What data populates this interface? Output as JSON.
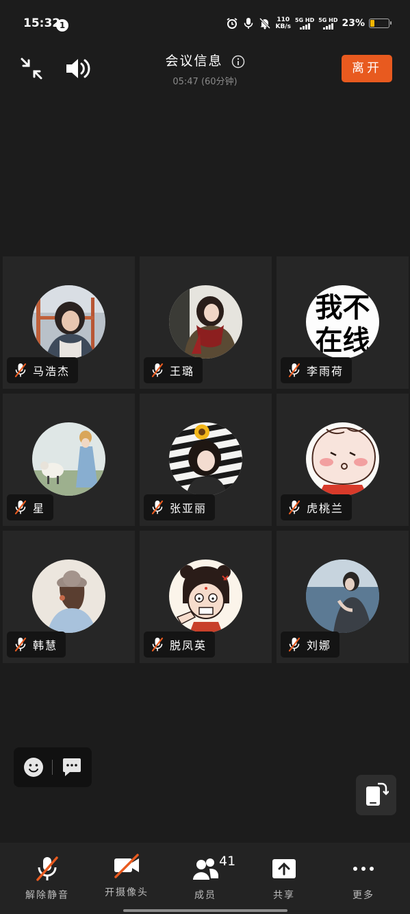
{
  "status_bar": {
    "time": "15:32",
    "notification_count": "1",
    "net_speed_value": "110",
    "net_speed_unit": "KB/s",
    "sim1": "5G HD",
    "sim2": "5G HD",
    "battery_percent": "23%",
    "battery_color": "#f0b400"
  },
  "header": {
    "title": "会议信息",
    "subtitle": "05:47 (60分钟)",
    "leave_label": "离开",
    "leave_color": "#e85a1f"
  },
  "participants": [
    {
      "name": "马浩杰",
      "muted": true,
      "avatar": "photo-girl-classroom"
    },
    {
      "name": "王璐",
      "muted": true,
      "avatar": "photo-girl-red-scarf"
    },
    {
      "name": "李雨荷",
      "muted": true,
      "avatar": "text-not-online",
      "avatar_text_1": "我不",
      "avatar_text_2": "在线"
    },
    {
      "name": "星",
      "muted": true,
      "avatar": "photo-girl-with-sheep"
    },
    {
      "name": "张亚丽",
      "muted": true,
      "avatar": "photo-girl-sunflower"
    },
    {
      "name": "虎桃兰",
      "muted": true,
      "avatar": "cartoon-boy-blushing"
    },
    {
      "name": "韩慧",
      "muted": true,
      "avatar": "photo-girl-hat-back"
    },
    {
      "name": "脱凤英",
      "muted": true,
      "avatar": "cartoon-girl-angry"
    },
    {
      "name": "刘娜",
      "muted": true,
      "avatar": "photo-girl-sea"
    }
  ],
  "bottom_bar": {
    "unmute_label": "解除静音",
    "camera_label": "开摄像头",
    "members_label": "成员",
    "members_count": "41",
    "share_label": "共享",
    "more_label": "更多"
  }
}
